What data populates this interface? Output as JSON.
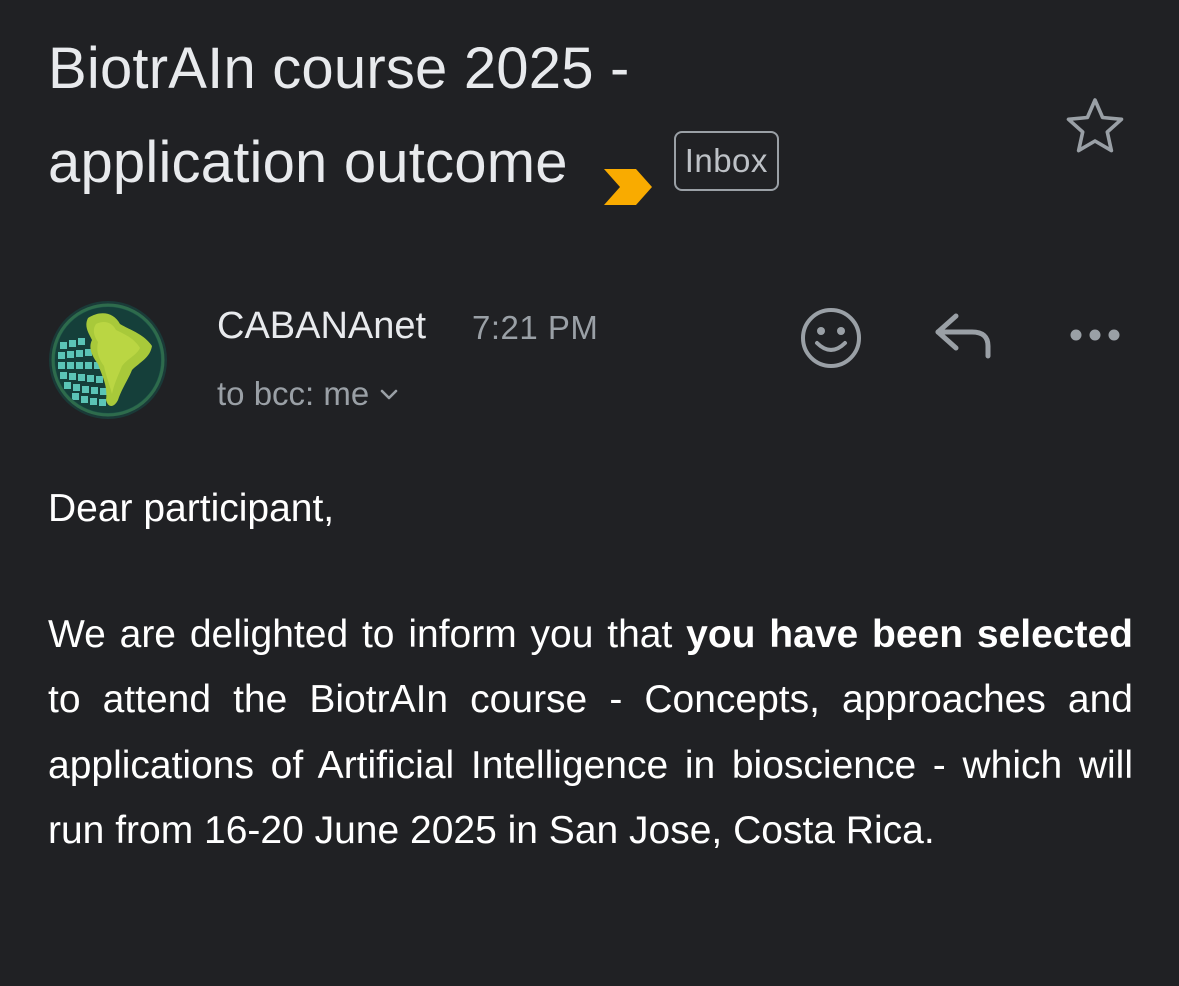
{
  "email": {
    "subject_line1": "BiotrAIn course 2025 -",
    "subject_line2": "application outcome",
    "label_chip": "Inbox",
    "importance_color": "#f9ab00",
    "sender_name": "CABANAnet",
    "time": "7:21 PM",
    "recipient": "to bcc: me",
    "icons": {
      "star": "star-outline-icon",
      "emoji": "emoji-smile-icon",
      "reply": "reply-arrow-icon",
      "more": "more-horizontal-icon",
      "expand": "chevron-down-icon",
      "importance": "importance-marker-icon",
      "avatar": "cabananet-globe-logo"
    },
    "body": {
      "greeting": "Dear participant,",
      "p1_part1": "We are delighted to inform you that ",
      "p1_bold": "you have been selected",
      "p1_part2": " to attend the BiotrAIn course -  Concepts, approaches and applications of Artificial Intelligence in bioscience - which will run from 16-20 June 2025 in San Jose, Costa Rica."
    }
  }
}
